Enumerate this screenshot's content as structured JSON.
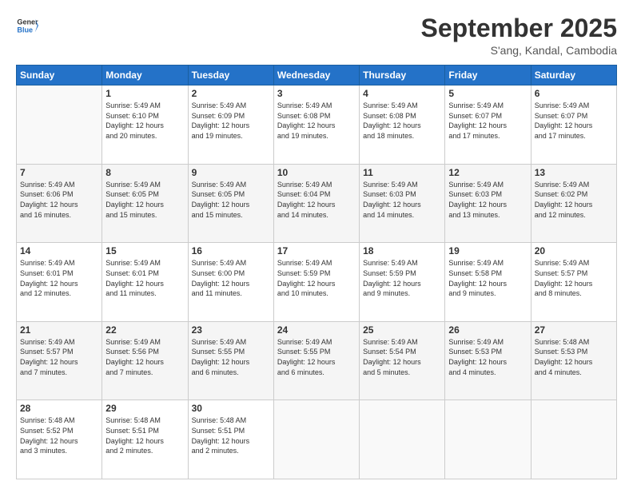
{
  "header": {
    "logo_general": "General",
    "logo_blue": "Blue",
    "month_title": "September 2025",
    "location": "S'ang, Kandal, Cambodia"
  },
  "days_of_week": [
    "Sunday",
    "Monday",
    "Tuesday",
    "Wednesday",
    "Thursday",
    "Friday",
    "Saturday"
  ],
  "weeks": [
    [
      {
        "day": "",
        "info": ""
      },
      {
        "day": "1",
        "info": "Sunrise: 5:49 AM\nSunset: 6:10 PM\nDaylight: 12 hours\nand 20 minutes."
      },
      {
        "day": "2",
        "info": "Sunrise: 5:49 AM\nSunset: 6:09 PM\nDaylight: 12 hours\nand 19 minutes."
      },
      {
        "day": "3",
        "info": "Sunrise: 5:49 AM\nSunset: 6:08 PM\nDaylight: 12 hours\nand 19 minutes."
      },
      {
        "day": "4",
        "info": "Sunrise: 5:49 AM\nSunset: 6:08 PM\nDaylight: 12 hours\nand 18 minutes."
      },
      {
        "day": "5",
        "info": "Sunrise: 5:49 AM\nSunset: 6:07 PM\nDaylight: 12 hours\nand 17 minutes."
      },
      {
        "day": "6",
        "info": "Sunrise: 5:49 AM\nSunset: 6:07 PM\nDaylight: 12 hours\nand 17 minutes."
      }
    ],
    [
      {
        "day": "7",
        "info": "Sunrise: 5:49 AM\nSunset: 6:06 PM\nDaylight: 12 hours\nand 16 minutes."
      },
      {
        "day": "8",
        "info": "Sunrise: 5:49 AM\nSunset: 6:05 PM\nDaylight: 12 hours\nand 15 minutes."
      },
      {
        "day": "9",
        "info": "Sunrise: 5:49 AM\nSunset: 6:05 PM\nDaylight: 12 hours\nand 15 minutes."
      },
      {
        "day": "10",
        "info": "Sunrise: 5:49 AM\nSunset: 6:04 PM\nDaylight: 12 hours\nand 14 minutes."
      },
      {
        "day": "11",
        "info": "Sunrise: 5:49 AM\nSunset: 6:03 PM\nDaylight: 12 hours\nand 14 minutes."
      },
      {
        "day": "12",
        "info": "Sunrise: 5:49 AM\nSunset: 6:03 PM\nDaylight: 12 hours\nand 13 minutes."
      },
      {
        "day": "13",
        "info": "Sunrise: 5:49 AM\nSunset: 6:02 PM\nDaylight: 12 hours\nand 12 minutes."
      }
    ],
    [
      {
        "day": "14",
        "info": "Sunrise: 5:49 AM\nSunset: 6:01 PM\nDaylight: 12 hours\nand 12 minutes."
      },
      {
        "day": "15",
        "info": "Sunrise: 5:49 AM\nSunset: 6:01 PM\nDaylight: 12 hours\nand 11 minutes."
      },
      {
        "day": "16",
        "info": "Sunrise: 5:49 AM\nSunset: 6:00 PM\nDaylight: 12 hours\nand 11 minutes."
      },
      {
        "day": "17",
        "info": "Sunrise: 5:49 AM\nSunset: 5:59 PM\nDaylight: 12 hours\nand 10 minutes."
      },
      {
        "day": "18",
        "info": "Sunrise: 5:49 AM\nSunset: 5:59 PM\nDaylight: 12 hours\nand 9 minutes."
      },
      {
        "day": "19",
        "info": "Sunrise: 5:49 AM\nSunset: 5:58 PM\nDaylight: 12 hours\nand 9 minutes."
      },
      {
        "day": "20",
        "info": "Sunrise: 5:49 AM\nSunset: 5:57 PM\nDaylight: 12 hours\nand 8 minutes."
      }
    ],
    [
      {
        "day": "21",
        "info": "Sunrise: 5:49 AM\nSunset: 5:57 PM\nDaylight: 12 hours\nand 7 minutes."
      },
      {
        "day": "22",
        "info": "Sunrise: 5:49 AM\nSunset: 5:56 PM\nDaylight: 12 hours\nand 7 minutes."
      },
      {
        "day": "23",
        "info": "Sunrise: 5:49 AM\nSunset: 5:55 PM\nDaylight: 12 hours\nand 6 minutes."
      },
      {
        "day": "24",
        "info": "Sunrise: 5:49 AM\nSunset: 5:55 PM\nDaylight: 12 hours\nand 6 minutes."
      },
      {
        "day": "25",
        "info": "Sunrise: 5:49 AM\nSunset: 5:54 PM\nDaylight: 12 hours\nand 5 minutes."
      },
      {
        "day": "26",
        "info": "Sunrise: 5:49 AM\nSunset: 5:53 PM\nDaylight: 12 hours\nand 4 minutes."
      },
      {
        "day": "27",
        "info": "Sunrise: 5:48 AM\nSunset: 5:53 PM\nDaylight: 12 hours\nand 4 minutes."
      }
    ],
    [
      {
        "day": "28",
        "info": "Sunrise: 5:48 AM\nSunset: 5:52 PM\nDaylight: 12 hours\nand 3 minutes."
      },
      {
        "day": "29",
        "info": "Sunrise: 5:48 AM\nSunset: 5:51 PM\nDaylight: 12 hours\nand 2 minutes."
      },
      {
        "day": "30",
        "info": "Sunrise: 5:48 AM\nSunset: 5:51 PM\nDaylight: 12 hours\nand 2 minutes."
      },
      {
        "day": "",
        "info": ""
      },
      {
        "day": "",
        "info": ""
      },
      {
        "day": "",
        "info": ""
      },
      {
        "day": "",
        "info": ""
      }
    ]
  ]
}
